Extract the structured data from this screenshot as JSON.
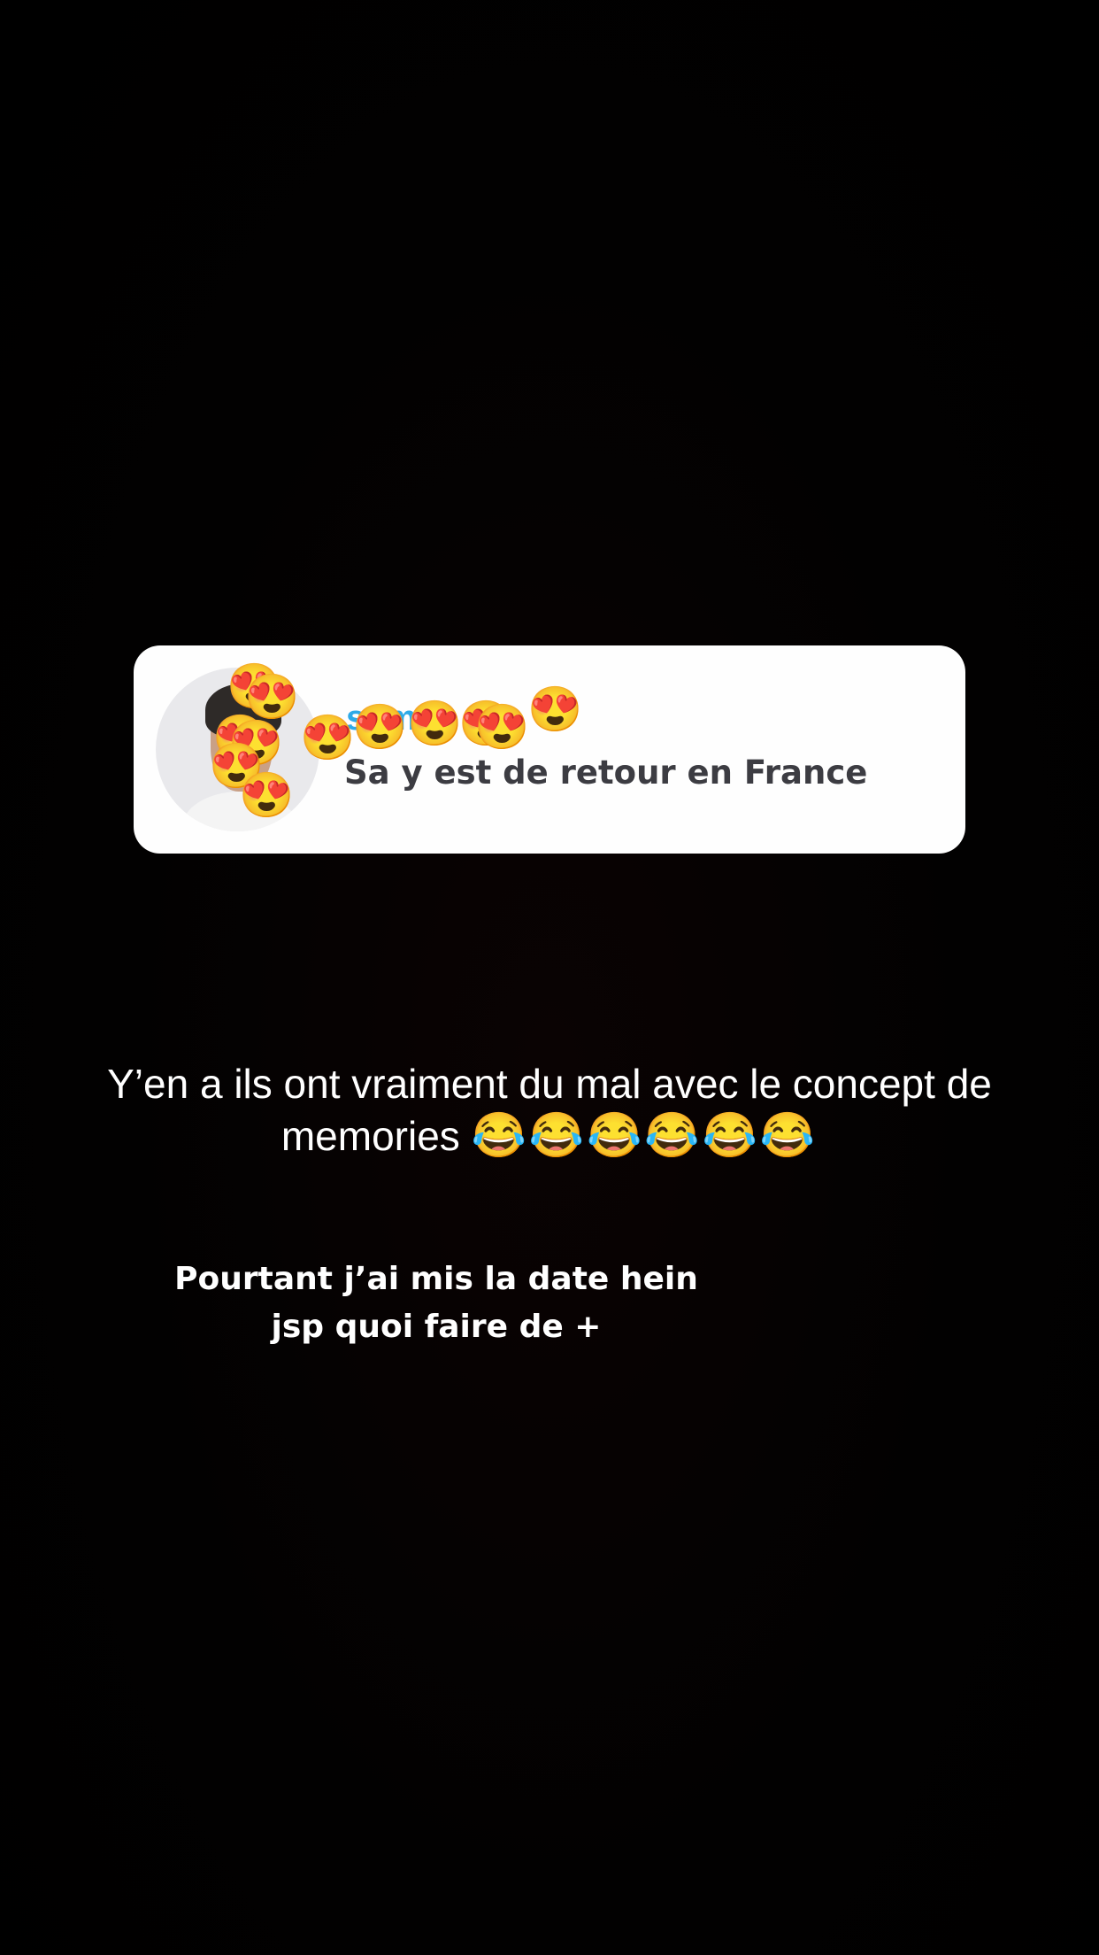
{
  "story_reply": {
    "username": "sam",
    "message": "Sa y est de retour en France"
  },
  "stickers": {
    "emoji": "😍",
    "count": 13
  },
  "caption": {
    "line1": "Y’en a ils ont vraiment du mal avec le concept de",
    "line2": "memories",
    "emoji": "😂😂😂😂😂😂"
  },
  "overlay_text": {
    "line1": "Pourtant j’ai mis la date hein",
    "line2": "jsp quoi faire de +"
  },
  "colors": {
    "background": "#000000",
    "card": "#fefefe",
    "username": "#2eaae8",
    "message": "#3c3c42",
    "text": "#ffffff"
  }
}
